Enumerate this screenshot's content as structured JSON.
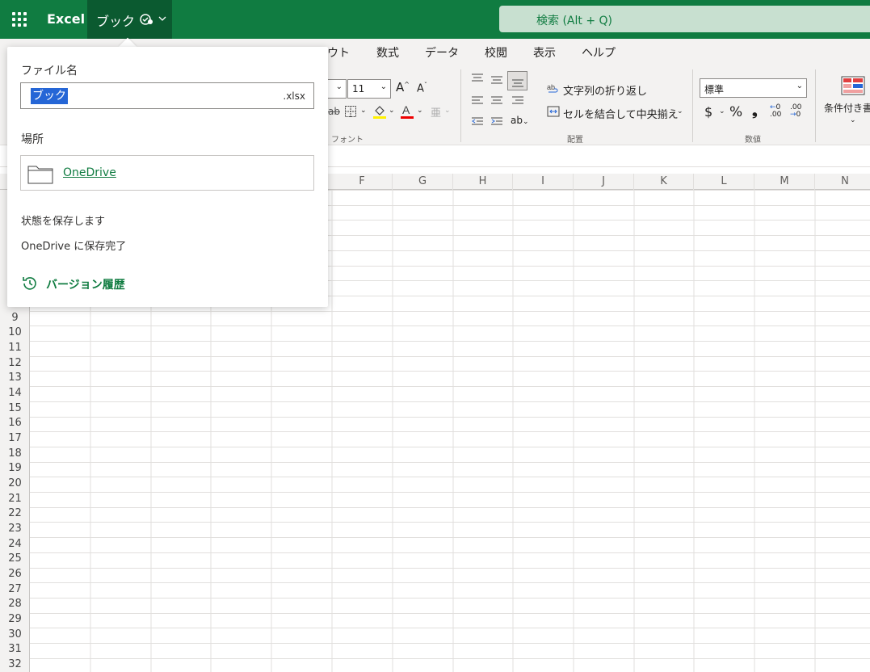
{
  "titlebar": {
    "app_name": "Excel",
    "doc_name": "ブック",
    "search_placeholder": "検索 (Alt + Q)",
    "colors": {
      "bar": "#107c41",
      "doc_button": "#0b5a30"
    }
  },
  "ribbon": {
    "tabs": [
      "ウト",
      "数式",
      "データ",
      "校閲",
      "表示",
      "ヘルプ"
    ],
    "font": {
      "size_value": "11",
      "group_label": "フォント"
    },
    "alignment": {
      "wrap_text": "文字列の折り返し",
      "merge_center": "セルを結合して中央揃え",
      "group_label": "配置"
    },
    "number": {
      "format_value": "標準",
      "currency": "$",
      "percent": "%",
      "comma": "❟",
      "group_label": "数値"
    },
    "styles": {
      "conditional_format": "条件付き書"
    }
  },
  "grid": {
    "columns": [
      "F",
      "G",
      "H",
      "I",
      "J",
      "K",
      "L",
      "M",
      "N"
    ],
    "rows": [
      "9",
      "10",
      "11",
      "12",
      "13",
      "14",
      "15",
      "16",
      "17",
      "18",
      "19",
      "20",
      "21",
      "22",
      "23",
      "24",
      "25",
      "26",
      "27",
      "28",
      "29",
      "30",
      "31",
      "32"
    ]
  },
  "flyout": {
    "filename_label": "ファイル名",
    "filename_value": "ブック",
    "extension": ".xlsx",
    "location_label": "場所",
    "location_value": "OneDrive",
    "status_line1": "状態を保存します",
    "status_line2": "OneDrive に保存完了",
    "version_history": "バージョン履歴"
  }
}
